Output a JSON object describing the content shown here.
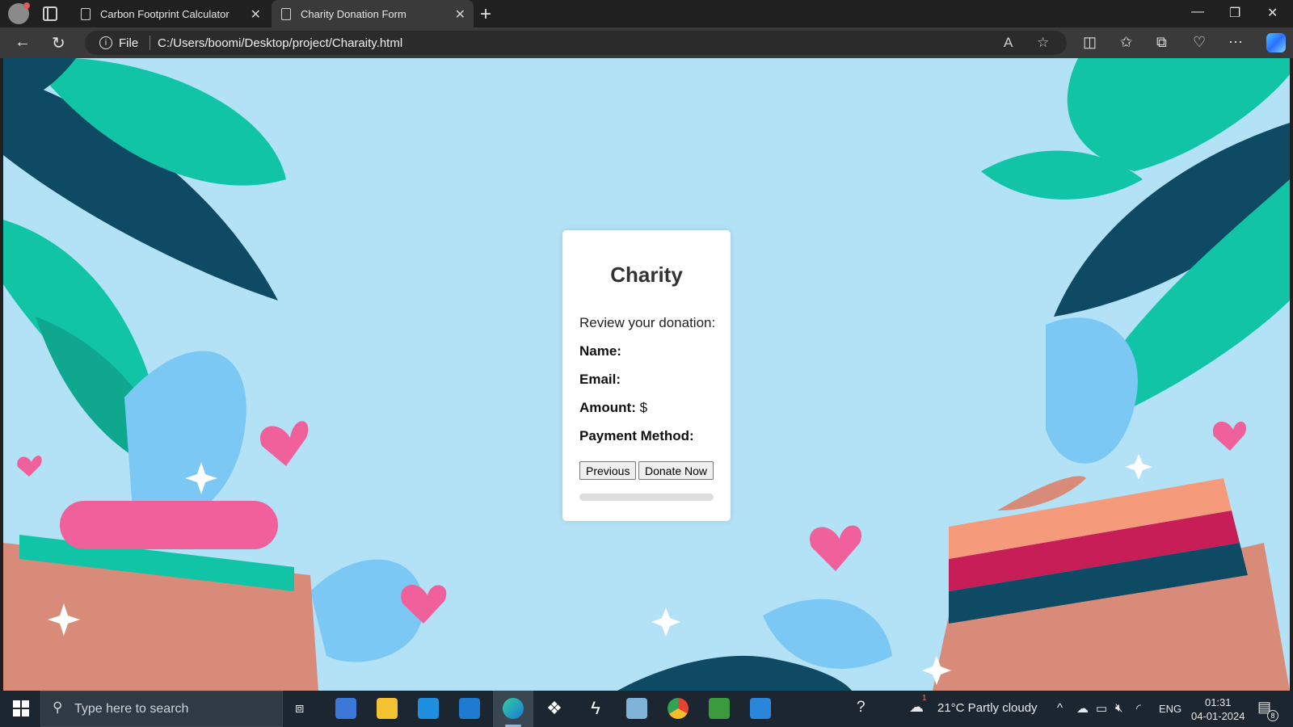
{
  "browser": {
    "tabs": [
      {
        "title": "Carbon Footprint Calculator",
        "active": false
      },
      {
        "title": "Charity Donation Form",
        "active": true
      }
    ],
    "address": {
      "scheme_label": "File",
      "url": "C:/Users/boomi/Desktop/project/Charaity.html"
    }
  },
  "page": {
    "title": "Charity",
    "review_text": "Review your donation:",
    "fields": [
      {
        "label": "Name:",
        "value": ""
      },
      {
        "label": "Email:",
        "value": ""
      },
      {
        "label": "Amount:",
        "value": "$"
      },
      {
        "label": "Payment Method:",
        "value": ""
      }
    ],
    "buttons": {
      "previous": "Previous",
      "donate": "Donate Now"
    },
    "progress": 0
  },
  "taskbar": {
    "search_placeholder": "Type here to search",
    "weather": "21°C  Partly cloudy",
    "weather_badge": "1",
    "language": "ENG",
    "time": "01:31",
    "date": "04-01-2024",
    "notification_count": "8"
  },
  "colors": {
    "page_background": "#b3e2f7",
    "leaf_teal": "#12c4a6",
    "leaf_navy": "#0e4a63",
    "heart_pink": "#f0609a",
    "taskbar": "#1c2630"
  }
}
